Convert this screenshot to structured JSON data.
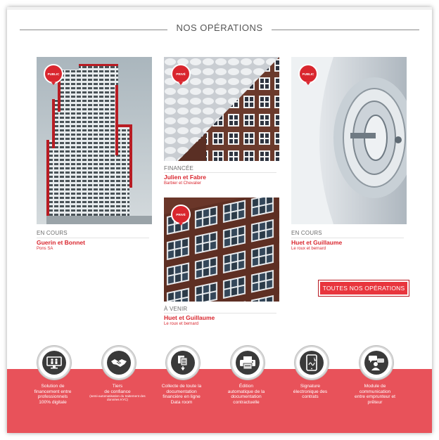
{
  "section": {
    "title": "NOS OPÉRATIONS"
  },
  "operations": [
    {
      "badge": "PUBLIC",
      "status": "EN COURS",
      "name": "Guerin et Bonnet",
      "company": "Pons SA"
    },
    {
      "badge": "PRIVÉ",
      "status": "FINANCÉE",
      "name": "Julien et Fabre",
      "company": "Barbier et Chevalier"
    },
    {
      "badge": "PUBLIC",
      "status": "EN COURS",
      "name": "Huet et Guillaume",
      "company": "Le roux et bernard"
    },
    {
      "badge": "PRIVÉ",
      "status": "À VENIR",
      "name": "Huet et Guillaume",
      "company": "Le roux et bernard"
    }
  ],
  "cta": {
    "label": "TOUTES NOS OPÉRATIONS"
  },
  "features": [
    {
      "icon": "monitor-people-icon",
      "lines": [
        "Solution de",
        "financement entre",
        "professionnels",
        "100% digitale"
      ],
      "small": ""
    },
    {
      "icon": "handshake-icon",
      "lines": [
        "Tiers",
        "de confiance"
      ],
      "small": "(semi-automatisation du traitement des données KYC)"
    },
    {
      "icon": "documents-download-icon",
      "lines": [
        "Collecte de toute la",
        "documentation",
        "financière en ligne",
        "Data room"
      ],
      "small": ""
    },
    {
      "icon": "printer-icon",
      "lines": [
        "Édition",
        "automatique de la",
        "documentation",
        "contractuelle"
      ],
      "small": ""
    },
    {
      "icon": "tablet-signature-icon",
      "lines": [
        "Signature",
        "électronique des",
        "contrats"
      ],
      "small": ""
    },
    {
      "icon": "chat-person-icon",
      "lines": [
        "Module de",
        "communication",
        "entre emprunteur et",
        "prêteur"
      ],
      "small": ""
    }
  ],
  "colors": {
    "accent": "#d9262e",
    "band": "#e8525a"
  }
}
